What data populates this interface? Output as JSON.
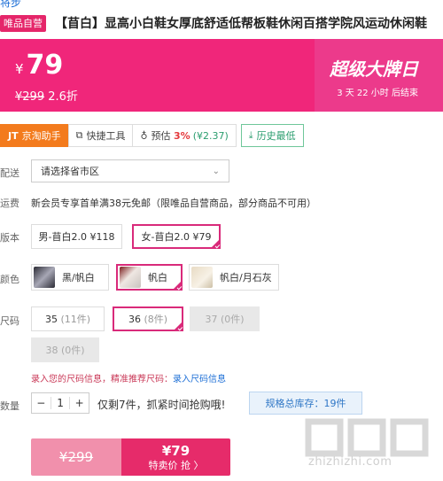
{
  "top_link": "将步",
  "title": {
    "badge": "唯品自营",
    "text": "【苜白】显高小白鞋女厚底舒适低帮板鞋休闲百搭学院风运动休闲鞋"
  },
  "price": {
    "currency": "¥",
    "value": "79",
    "original": "¥299",
    "discount": "2.6折",
    "sale_title": "超级大牌日",
    "countdown": "3 天 22 小时 后结束"
  },
  "tools": {
    "jt_logo": "JT",
    "jt_label": "京淘助手",
    "quick_label": "快捷工具",
    "estimate_label": "预估",
    "estimate_pct": "3%",
    "estimate_amt": "(¥2.37)",
    "history_label": "历史最低"
  },
  "delivery": {
    "label": "配送",
    "placeholder": "请选择省市区"
  },
  "shipping": {
    "label": "运费",
    "text": "新会员专享首单满38元免邮（限唯品自营商品，部分商品不可用）"
  },
  "version": {
    "label": "版本",
    "options": [
      {
        "label": "男-苜白2.0 ¥118",
        "selected": false
      },
      {
        "label": "女-苜白2.0 ¥79",
        "selected": true
      }
    ]
  },
  "color": {
    "label": "颜色",
    "options": [
      {
        "label": "黑/帆白",
        "selected": false
      },
      {
        "label": "帆白",
        "selected": true
      },
      {
        "label": "帆白/月石灰",
        "selected": false
      }
    ]
  },
  "size": {
    "label": "尺码",
    "options": [
      {
        "size": "35",
        "count": "(11件)",
        "state": "normal"
      },
      {
        "size": "36",
        "count": "(8件)",
        "state": "selected"
      },
      {
        "size": "37",
        "count": "(0件)",
        "state": "disabled"
      },
      {
        "size": "38",
        "count": "(0件)",
        "state": "disabled"
      }
    ],
    "tip": "录入您的尺码信息，精准推荐尺码：",
    "tip_link": "录入尺码信息"
  },
  "quantity": {
    "label": "数量",
    "minus": "−",
    "value": "1",
    "plus": "+",
    "stock_warning": "仅剩7件，抓紧时间抢购哦!",
    "stock_total": "规格总库存：19件"
  },
  "buy": {
    "original": "¥299",
    "price": "¥79",
    "action": "特卖价 抢 〉"
  },
  "watermark": {
    "text": "zhizhizhi.com"
  }
}
